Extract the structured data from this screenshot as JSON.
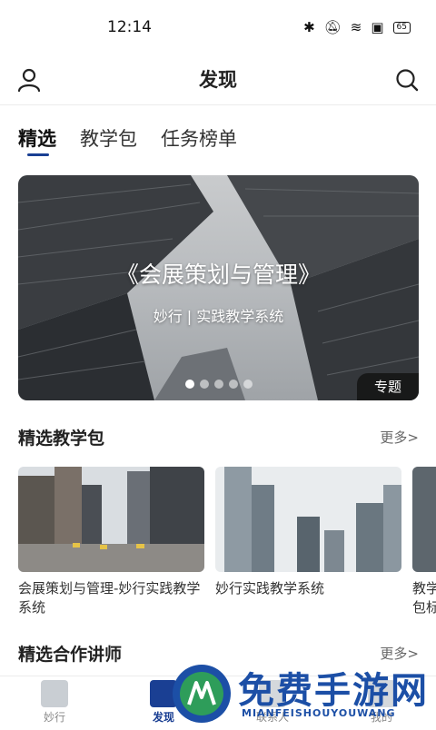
{
  "status": {
    "time": "12:14",
    "battery": "65"
  },
  "header": {
    "title": "发现"
  },
  "tabs": [
    "精选",
    "教学包",
    "任务榜单"
  ],
  "banner": {
    "title": "《会展策划与管理》",
    "subtitle": "妙行 | 实践教学系统",
    "badge": "专题",
    "dot_count": 5,
    "active_dot": 0
  },
  "featured": {
    "title": "精选教学包",
    "more": "更多>",
    "cards": [
      {
        "title": "会展策划与管理-妙行实践教学系统"
      },
      {
        "title": "妙行实践教学系统"
      },
      {
        "title": "教学包标"
      }
    ]
  },
  "instructors": {
    "title": "精选合作讲师",
    "more": "更多>"
  },
  "tabbar": [
    {
      "label": "妙行"
    },
    {
      "label": "发现"
    },
    {
      "label": "联系人"
    },
    {
      "label": "我的"
    }
  ],
  "watermark": {
    "text": "免费手游网",
    "sub": "MIANFEISHOUYOUWANG"
  },
  "colors": {
    "accent": "#1a3f93",
    "watermark": "#1c4fa6"
  }
}
